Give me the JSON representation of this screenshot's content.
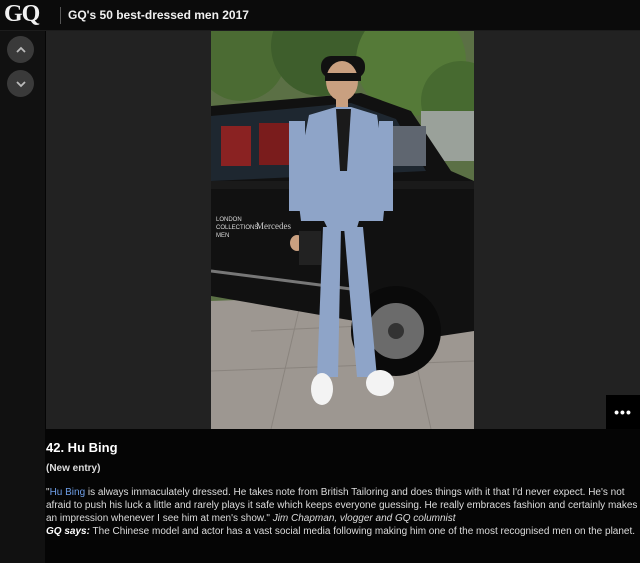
{
  "header": {
    "logo": "GQ",
    "title": "GQ's 50 best-dressed men 2017"
  },
  "nav": {
    "up_icon": "chevron-up-icon",
    "down_icon": "chevron-down-icon"
  },
  "more_button": {
    "label": "•••",
    "icon": "more-icon"
  },
  "caption": {
    "title": "42. Hu Bing",
    "subtitle": "(New entry)",
    "quote_open": "\"",
    "quote_link": "Hu Bing",
    "quote_text": " is always immaculately dressed. He takes note from British Tailoring and does things with it that I'd never expect. He's not afraid to push his luck a little and rarely plays it safe which keeps everyone guessing. He really embraces fashion and certainly makes an impression whenever I see him at men's show.\" ",
    "attribution": "Jim Chapman, vlogger and GQ columnist",
    "gq_says_label": "GQ says:",
    "gq_says_text": " The Chinese model and actor has a vast social media following making him one of the most recognised men on the planet."
  },
  "photo": {
    "vehicle_text_1": "LONDON",
    "vehicle_text_2": "COLLECTIONS",
    "vehicle_text_3": "MEN",
    "vehicle_brand": "Mercedes"
  },
  "colors": {
    "link": "#6f9fe8",
    "background": "#050505",
    "stage": "#222222"
  }
}
